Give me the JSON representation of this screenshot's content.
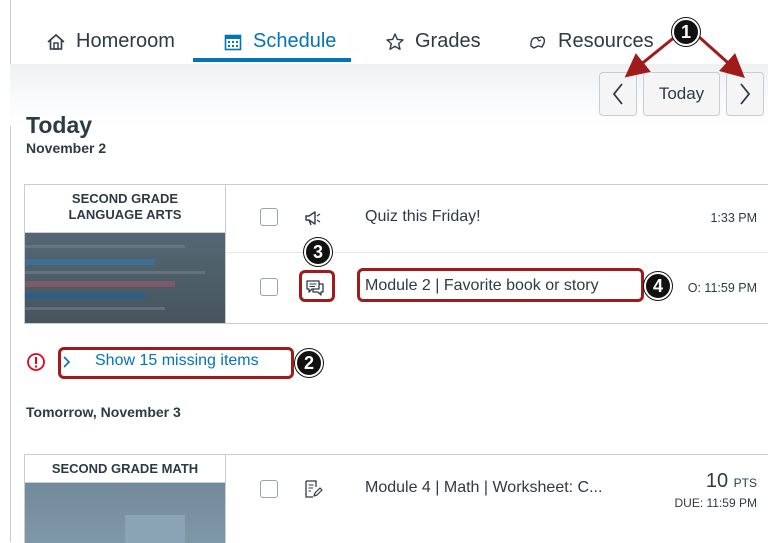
{
  "tabs": [
    {
      "label": "Homeroom",
      "icon": "home-icon"
    },
    {
      "label": "Schedule",
      "icon": "calendar-icon",
      "active": true
    },
    {
      "label": "Grades",
      "icon": "star-icon"
    },
    {
      "label": "Resources",
      "icon": "resources-icon"
    }
  ],
  "toolbar": {
    "prev_label": "<",
    "today_label": "Today",
    "next_label": ">"
  },
  "today": {
    "heading": "Today",
    "date": "November 2"
  },
  "course1": {
    "title_line1": "SECOND GRADE",
    "title_line2": "LANGUAGE ARTS",
    "items": [
      {
        "title": "Quiz this Friday!",
        "time": "1:33 PM",
        "icon": "announcement-icon"
      },
      {
        "title": "Module 2 | Favorite book or story",
        "time": "DUE: 11:59 PM",
        "time_visible": "O: 11:59 PM",
        "icon": "discussion-icon"
      }
    ]
  },
  "missing": {
    "label": "Show 15 missing items",
    "count": 15
  },
  "tomorrow": {
    "heading": "Tomorrow, November 3"
  },
  "course2": {
    "title": "SECOND GRADE MATH",
    "items": [
      {
        "title": "Module 4 | Math | Worksheet: C...",
        "points": "10",
        "points_unit": "PTS",
        "time": "DUE: 11:59 PM",
        "icon": "assignment-icon"
      }
    ]
  },
  "callouts": [
    "1",
    "2",
    "3",
    "4"
  ],
  "colors": {
    "accent": "#0374b5",
    "callout": "#a01b1b",
    "error": "#e0061f"
  }
}
